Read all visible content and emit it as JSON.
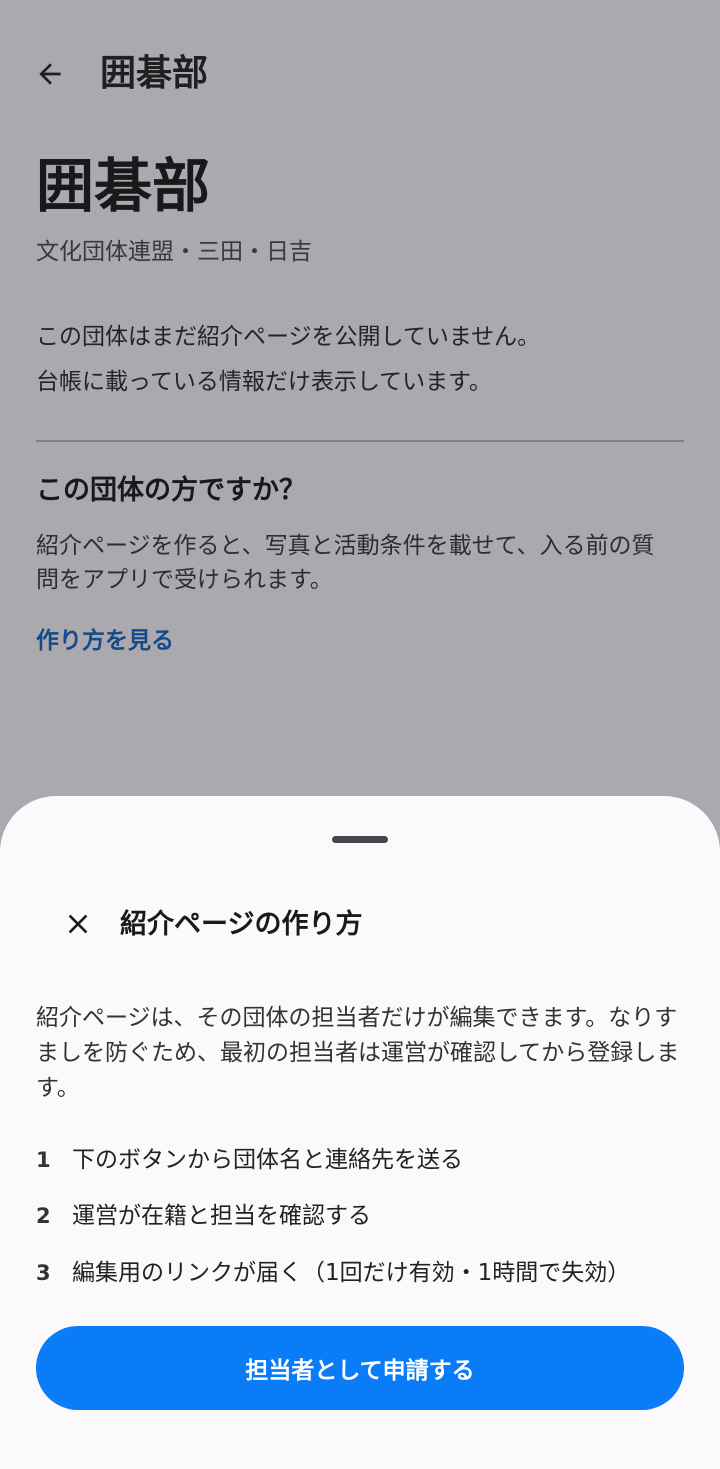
{
  "appbar": {
    "title": "囲碁部",
    "back_icon": "arrow-back-icon"
  },
  "org": {
    "title": "囲碁部",
    "subtitle": "文化団体連盟・三田・日吉",
    "notice_line1": "この団体はまだ紹介ページを公開していません。",
    "notice_line2": "台帳に載っている情報だけ表示しています。"
  },
  "owner_section": {
    "heading": "この団体の方ですか？",
    "description": "紹介ページを作ると、写真と活動条件を載せて、入る前の質問をアプリで受けられます。",
    "link_label": "作り方を見る"
  },
  "sheet": {
    "close_icon": "close-icon",
    "title": "紹介ページの作り方",
    "description": "紹介ページは、その団体の担当者だけが編集できます。なりすましを防ぐため、最初の担当者は運営が確認してから登録します。",
    "steps": [
      {
        "num": "1",
        "text": "下のボタンから団体名と連絡先を送る"
      },
      {
        "num": "2",
        "text": "運営が在籍と担当を確認する"
      },
      {
        "num": "3",
        "text": "編集用のリンクが届く（1回だけ有効・1時間で失効）"
      }
    ],
    "apply_label": "担当者として申請する"
  },
  "colors": {
    "accent": "#0a7cf8",
    "link": "#0b63c4",
    "scrim": "rgba(40,38,44,0.38)",
    "surface": "#fcf9fd"
  }
}
